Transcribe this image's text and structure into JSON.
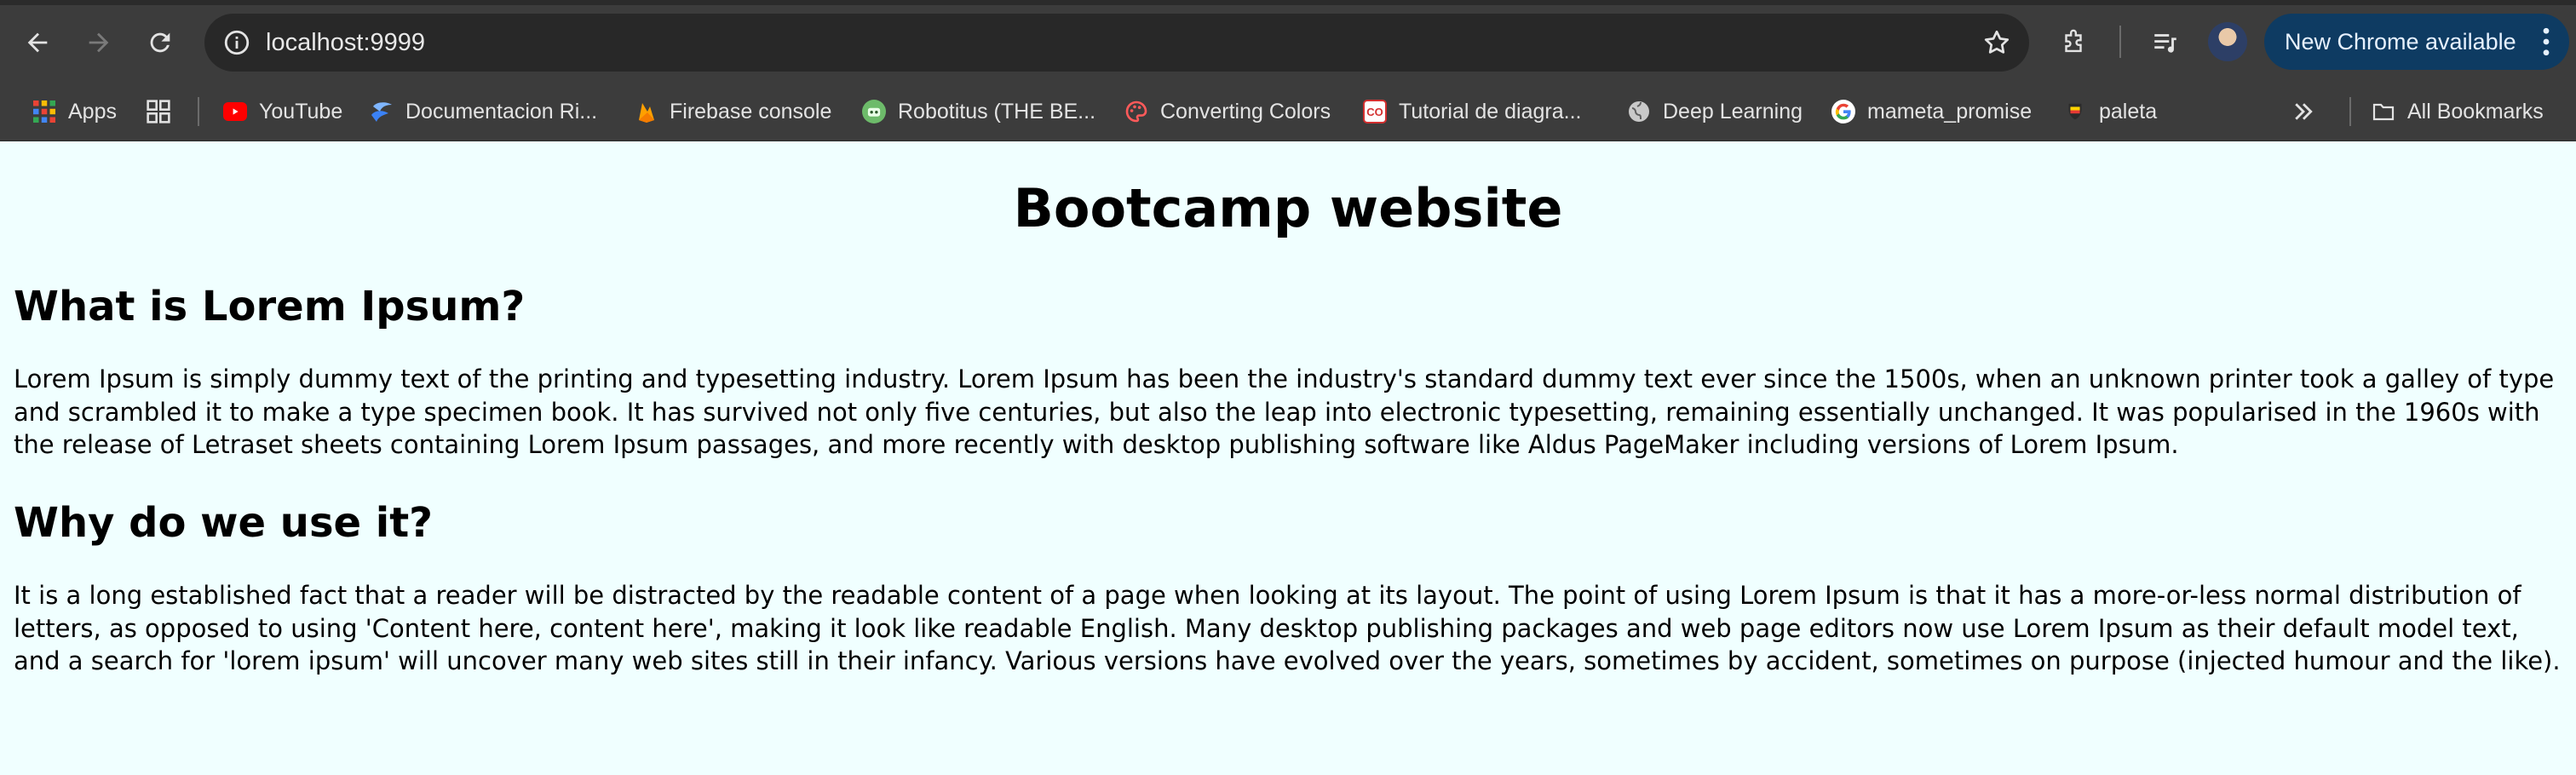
{
  "browser": {
    "url": "localhost:9999",
    "update_label": "New Chrome available",
    "accent": "#0e3b62"
  },
  "bookmarks": {
    "items": [
      {
        "label": "Apps",
        "icon": "apps-grid-icon"
      },
      {
        "label": "",
        "icon": "tab-groups-icon"
      },
      {
        "label": "YouTube",
        "icon": "youtube-icon"
      },
      {
        "label": "Documentacion Ri...",
        "icon": "docs-icon"
      },
      {
        "label": "Firebase console",
        "icon": "firebase-icon"
      },
      {
        "label": "Robotitus (THE BE...",
        "icon": "robot-icon"
      },
      {
        "label": "Converting Colors",
        "icon": "palette-icon"
      },
      {
        "label": "Tutorial de diagra...",
        "icon": "co-icon"
      },
      {
        "label": "Deep Learning",
        "icon": "globe-icon"
      },
      {
        "label": "mameta_promise",
        "icon": "google-icon"
      },
      {
        "label": "paleta",
        "icon": "paleta-icon"
      }
    ],
    "all_label": "All Bookmarks"
  },
  "page": {
    "title": "Bootcamp website",
    "section1": {
      "heading": "What is Lorem Ipsum?",
      "body": "Lorem Ipsum is simply dummy text of the printing and typesetting industry. Lorem Ipsum has been the industry's standard dummy text ever since the 1500s, when an unknown printer took a galley of type and scrambled it to make a type specimen book. It has survived not only five centuries, but also the leap into electronic typesetting, remaining essentially unchanged. It was popularised in the 1960s with the release of Letraset sheets containing Lorem Ipsum passages, and more recently with desktop publishing software like Aldus PageMaker including versions of Lorem Ipsum."
    },
    "section2": {
      "heading": "Why do we use it?",
      "body": "It is a long established fact that a reader will be distracted by the readable content of a page when looking at its layout. The point of using Lorem Ipsum is that it has a more-or-less normal distribution of letters, as opposed to using 'Content here, content here', making it look like readable English. Many desktop publishing packages and web page editors now use Lorem Ipsum as their default model text, and a search for 'lorem ipsum' will uncover many web sites still in their infancy. Various versions have evolved over the years, sometimes by accident, sometimes on purpose (injected humour and the like)."
    },
    "background": "#f0ffff"
  }
}
